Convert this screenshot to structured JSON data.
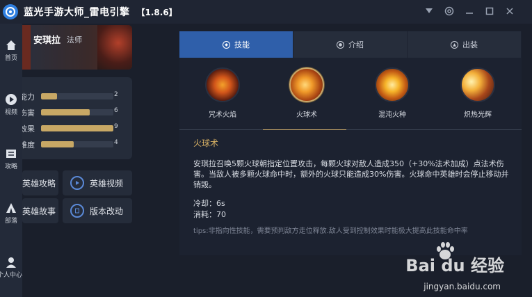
{
  "app": {
    "title": "蓝光手游大师_雷电引擎",
    "version": "【1.8.6】",
    "logo_icon": "app-logo-icon"
  },
  "window_controls": {
    "filter_icon": "▼",
    "settings_icon": "⚙",
    "minimize_icon": "—",
    "maximize_icon": "▢",
    "close_icon": "✕"
  },
  "nav": {
    "items": [
      {
        "label": "首页",
        "icon": "home-icon"
      },
      {
        "label": "视频",
        "icon": "play-icon"
      },
      {
        "label": "攻略",
        "icon": "guide-icon"
      },
      {
        "label": "部落",
        "icon": "tribe-icon"
      },
      {
        "label": "个人中心",
        "icon": "user-icon"
      }
    ]
  },
  "hero": {
    "name": "安琪拉",
    "role": "法师"
  },
  "stats": [
    {
      "label": "生存能力",
      "value": "2",
      "fill": 0.22
    },
    {
      "label": "攻击伤害",
      "value": "6",
      "fill": 0.67
    },
    {
      "label": "技能效果",
      "value": "9",
      "fill": 1.0
    },
    {
      "label": "上手难度",
      "value": "4",
      "fill": 0.45
    }
  ],
  "actions": {
    "guide": "英雄攻略",
    "video": "英雄视频",
    "story": "英雄故事",
    "changes": "版本改动"
  },
  "tabs": [
    {
      "label": "技能",
      "active": true
    },
    {
      "label": "介绍",
      "active": false
    },
    {
      "label": "出装",
      "active": false
    }
  ],
  "skills": [
    {
      "label": "咒术火焰",
      "active": false
    },
    {
      "label": "火球术",
      "active": true
    },
    {
      "label": "混沌火种",
      "active": false
    },
    {
      "label": "炽热光辉",
      "active": false
    }
  ],
  "skill_detail": {
    "name": "火球术",
    "description": "安琪拉召唤5颗火球朝指定位置攻击，每颗火球对敌人造成350（+30%法术加成）点法术伤害。当敌人被多颗火球命中时，额外的火球只能造成30%伤害。火球命中英雄时会停止移动并销毁。",
    "cooldown": "冷却：6s",
    "cost": "消耗：70",
    "tips": "tips:非指向性技能，需要预判敌方走位释放.敌人受到控制效果时能极大提高此技能命中率"
  },
  "watermark": {
    "brand": "Bai du 经验",
    "url": "jingyan.baidu.com"
  },
  "colors": {
    "accent_blue": "#2f5faa",
    "gold": "#c9a86a",
    "panel": "#252c3a"
  }
}
